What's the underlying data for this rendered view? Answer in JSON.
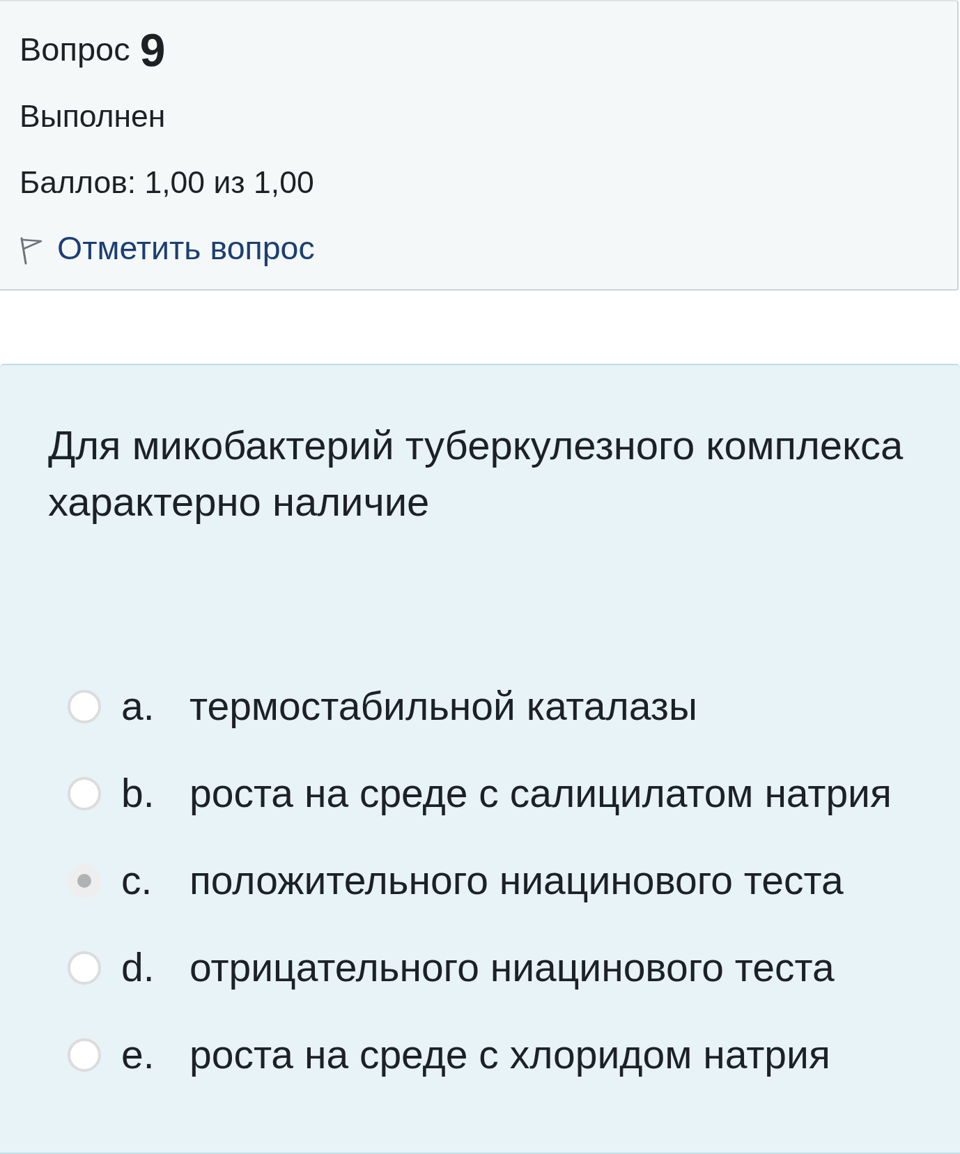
{
  "question_info": {
    "label": "Вопрос",
    "number": "9",
    "state": "Выполнен",
    "grade": "Баллов: 1,00 из 1,00",
    "flag_link": "Отметить вопрос"
  },
  "question": {
    "text": "Для микобактерий туберкулезного комплекса характерно наличие",
    "options": [
      {
        "letter": "a.",
        "text": "термостабильной каталазы",
        "selected": false
      },
      {
        "letter": "b.",
        "text": "роста на среде с салицилатом натрия",
        "selected": false
      },
      {
        "letter": "c.",
        "text": "положительного ниацинового теста",
        "selected": true
      },
      {
        "letter": "d.",
        "text": "отрицательного ниацинового теста",
        "selected": false
      },
      {
        "letter": "e.",
        "text": "роста на среде с хлоридом натрия",
        "selected": false
      }
    ]
  }
}
